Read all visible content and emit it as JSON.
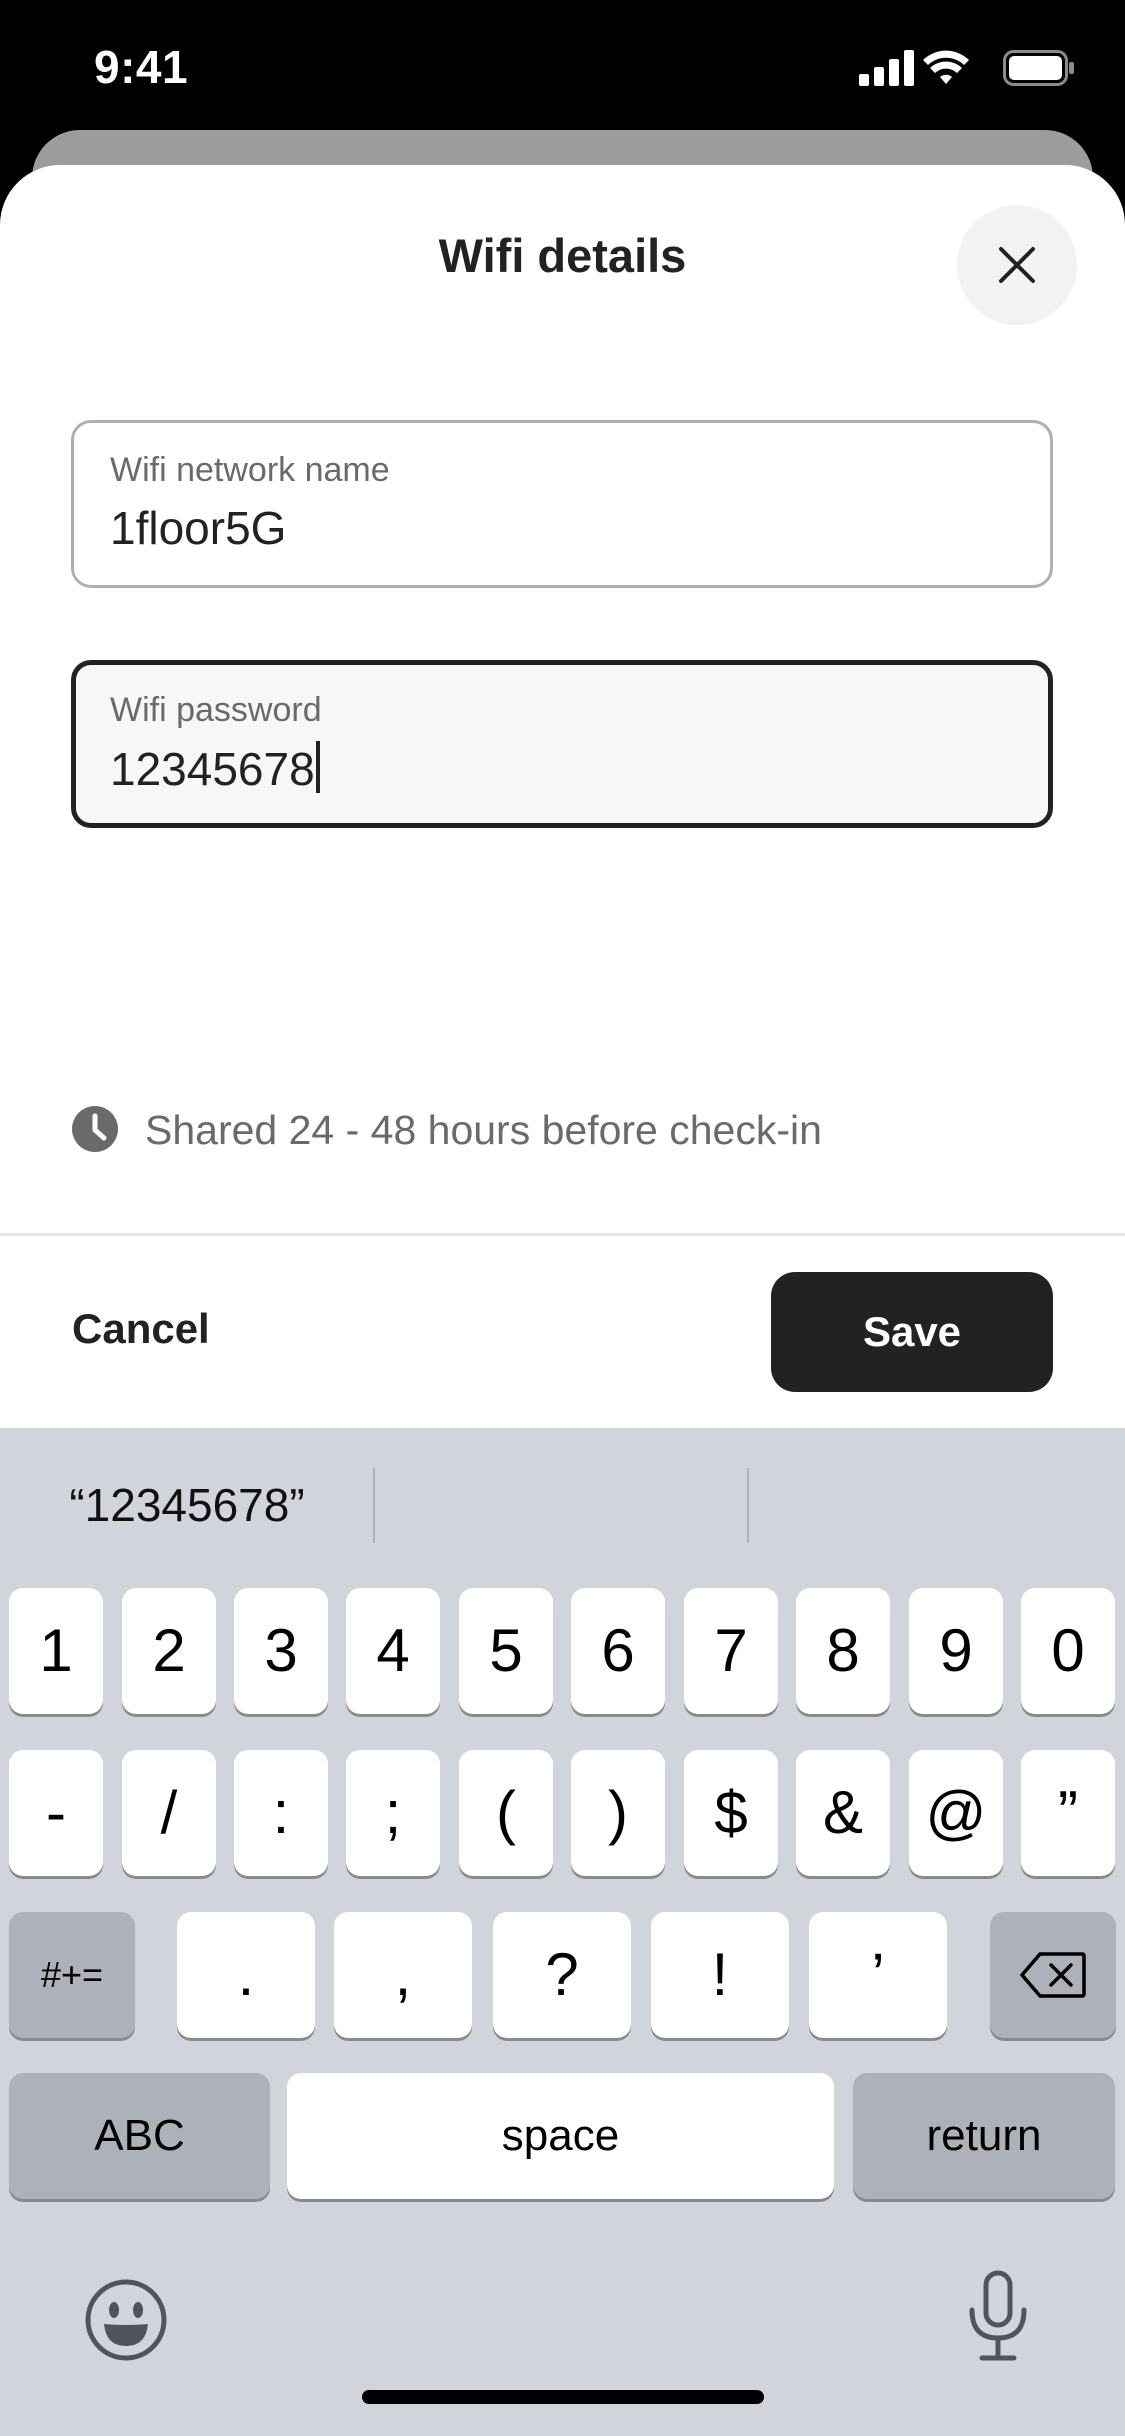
{
  "status_bar": {
    "time": "9:41"
  },
  "modal": {
    "title": "Wifi details",
    "network_field": {
      "label": "Wifi network name",
      "value": "1floor5G"
    },
    "password_field": {
      "label": "Wifi password",
      "value": "12345678"
    },
    "schedule_note": "Shared 24 - 48 hours before check-in",
    "cancel_label": "Cancel",
    "save_label": "Save"
  },
  "keyboard": {
    "suggestion": "“12345678”",
    "row1": [
      "1",
      "2",
      "3",
      "4",
      "5",
      "6",
      "7",
      "8",
      "9",
      "0"
    ],
    "row2": [
      "-",
      "/",
      ":",
      ";",
      "(",
      ")",
      "$",
      "&",
      "@",
      "”"
    ],
    "row3": [
      ".",
      ",",
      "?",
      "!",
      "’"
    ],
    "symbols_label": "#+=",
    "abc_label": "ABC",
    "space_label": "space",
    "return_label": "return"
  },
  "colors": {
    "accent": "#222222",
    "keyboard_bg": "#d1d4db",
    "secondary_text": "#6a6a6a"
  },
  "icons": [
    "signal-icon",
    "wifi-icon",
    "battery-icon",
    "close-icon",
    "clock-icon",
    "backspace-icon",
    "emoji-icon",
    "microphone-icon"
  ]
}
